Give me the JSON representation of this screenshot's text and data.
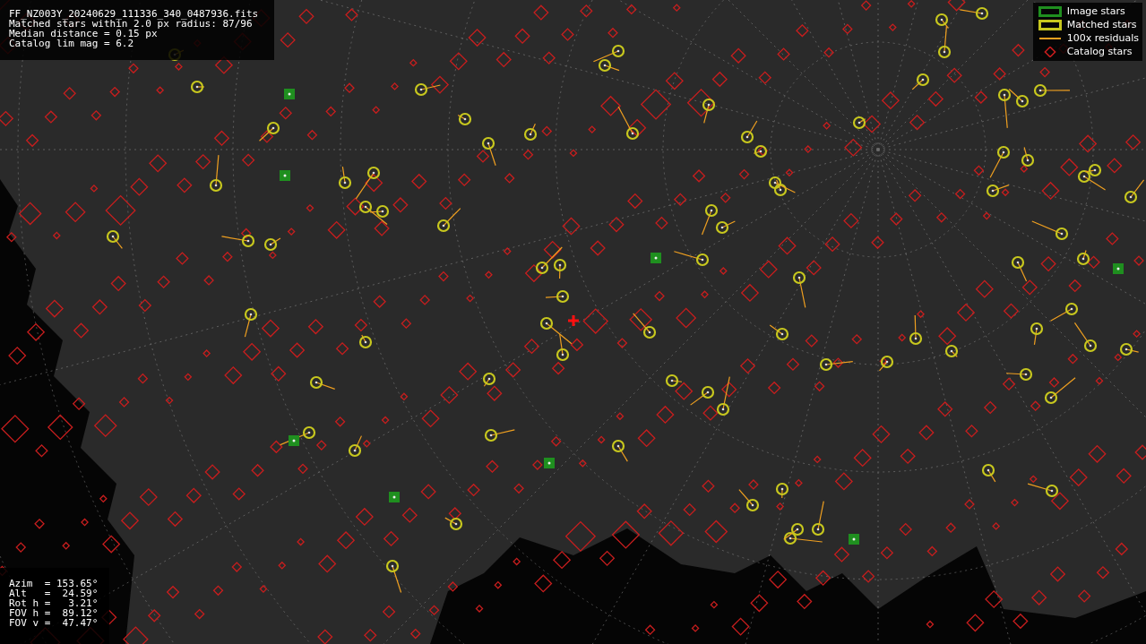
{
  "info_box": {
    "lines": [
      "FF_NZ003Y_20240629_111336_340_0487936.fits",
      "Matched stars within 2.0 px radius: 87/96",
      "Median distance = 0.15 px",
      "Catalog lim mag = 6.2"
    ]
  },
  "legend": {
    "items": [
      {
        "kind": "square",
        "label": "Image stars",
        "color": "#1f8f1f"
      },
      {
        "kind": "square",
        "label": "Matched stars",
        "color": "#c8c81e"
      },
      {
        "kind": "line",
        "label": "100x residuals",
        "color": "#f0a020"
      },
      {
        "kind": "diamond",
        "label": "Catalog stars",
        "color": "#c81e1e"
      }
    ]
  },
  "pointing_box": {
    "lines": [
      "Azim  = 153.65°",
      "Alt   =  24.59°",
      "Rot h =   3.21°",
      "FOV h =  89.12°",
      "FOV v =  47.47°"
    ]
  }
}
